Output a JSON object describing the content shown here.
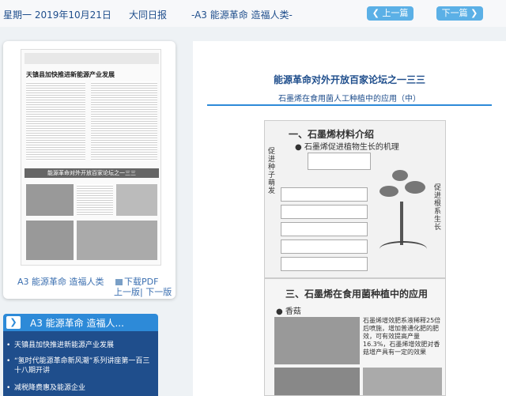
{
  "topbar": {
    "date": "星期一 2019年10月21日",
    "paper": "大同日报",
    "edition": "-A3 能源革命 造福人类-",
    "prev_label": "上一篇",
    "next_label": "下一篇"
  },
  "thumbnail": {
    "headline": "天镇县加快推进新能源产业发展",
    "band_text": "能源革命对外开放百家论坛之一三三",
    "caption": "A3 能源革命 造福人类",
    "download_label": "下载PDF",
    "prev_page": "上一版",
    "next_page": "下一版"
  },
  "menu": {
    "title": "A3  能源革命 造福人...",
    "items": [
      "天镇县加快推进新能源产业发展",
      "“氢时代能源革命新风潮”系列讲座第一百三十八期开讲",
      "减税降费惠及能源企业"
    ]
  },
  "article": {
    "title": "能源革命对外开放百家论坛之一三三",
    "subtitle": "石墨烯在食用菌人工种植中的应用（中）",
    "fig1_title": "一、石墨烯材料介绍",
    "fig1_sub": "● 石墨烯促进植物生长的机理",
    "fig1_caption_left": "促进种子萌发",
    "fig1_caption_right": "促进根系生长",
    "fig2_title": "三、石墨烯在食用菌种植中的应用",
    "fig2_sub": "● 香菇",
    "fig2_text": "石墨烯增效肥系液稀释25倍后喷施，增加普通化肥的肥效，可有效提高产量16.3%，石墨烯增效肥对香菇增产具有一定的效果"
  },
  "colors": {
    "accent": "#2d8ad8",
    "navy": "#1f4e8c",
    "button": "#5bb0e6"
  }
}
